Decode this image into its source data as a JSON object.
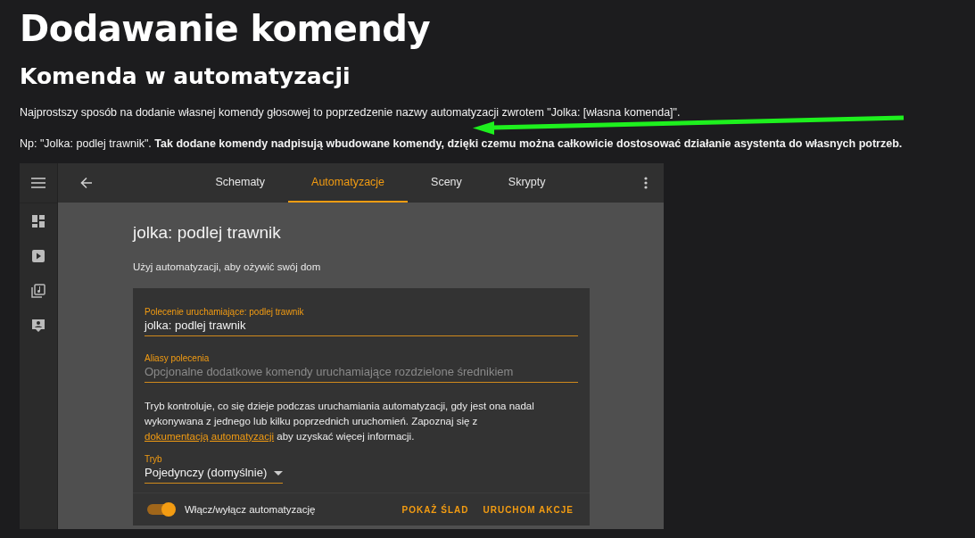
{
  "article": {
    "title": "Dodawanie komendy",
    "subtitle": "Komenda w automatyzacji",
    "paragraphs": [
      "Najprostszy sposób na dodanie własnej komendy głosowej to poprzedzenie nazwy automatyzacji zwrotem \"Jolka: [własna komenda]\".",
      "Np: \"Jolka: podlej trawnik\". **Tak dodane komendy nadpisują wbudowane komendy, dzięki czemu można całkowicie dostosować działanie asystenta do własnych potrzeb.**"
    ]
  },
  "embedded_screen": {
    "tabs": [
      {
        "label": "Schematy",
        "selected": false
      },
      {
        "label": "Automatyzacje",
        "selected": true
      },
      {
        "label": "Sceny",
        "selected": false
      },
      {
        "label": "Skrypty",
        "selected": false
      }
    ],
    "page_title": "jolka: podlej trawnik",
    "page_description": "Użyj automatyzacji, aby ożywić swój dom",
    "card": {
      "command_field": {
        "label": "Polecenie uruchamiające: podlej trawnik",
        "value": "jolka: podlej trawnik"
      },
      "aliases_field": {
        "label": "Aliasy polecenia",
        "placeholder": "Opcjonalne dodatkowe komendy uruchamiające rozdzielone średnikiem"
      },
      "mode_description": {
        "before": "Tryb kontroluje, co się dzieje podczas uruchamiania automatyzacji, gdy jest ona nadal wykonywana z jednego lub kilku poprzednich uruchomień. Zapoznaj się z",
        "link": "dokumentacją automatyzacji",
        "after": "aby uzyskać więcej informacji."
      },
      "mode_select": {
        "label": "Tryb",
        "value": "Pojedynczy (domyślnie)"
      },
      "toggle": {
        "label": "Włącz/wyłącz automatyzację",
        "on": true
      },
      "actions": [
        "POKAŻ ŚLAD",
        "URUCHOM AKCJE"
      ]
    }
  }
}
